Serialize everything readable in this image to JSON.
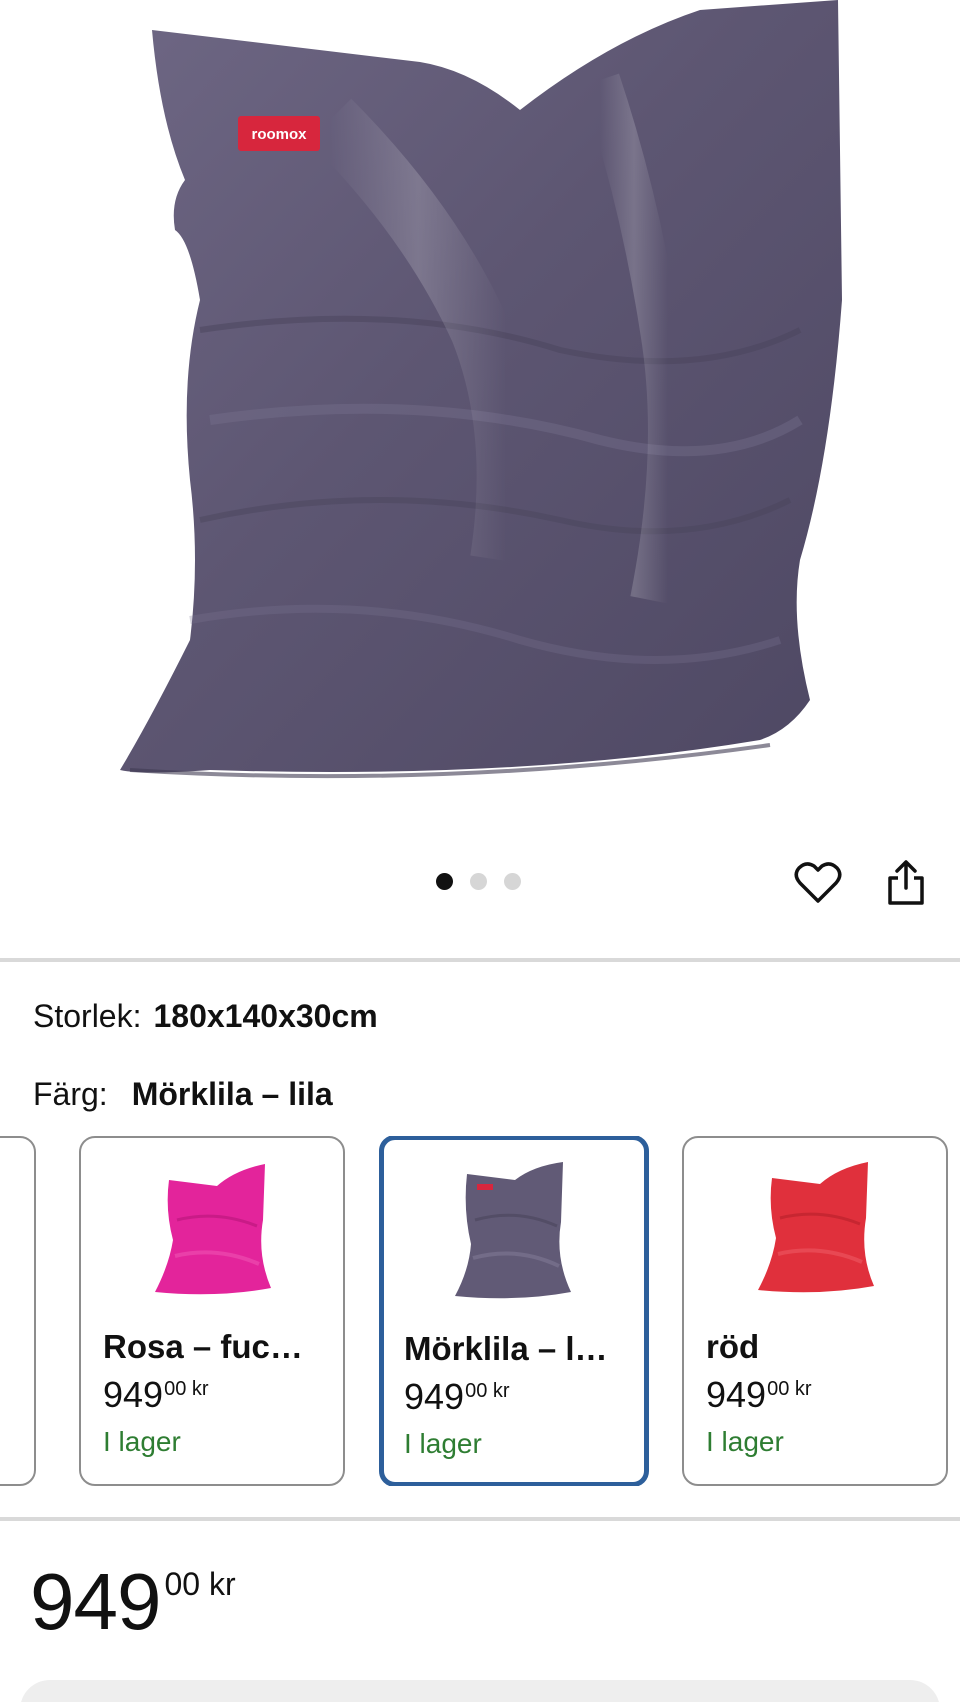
{
  "hero": {
    "logo_text": "roomox",
    "carousel": {
      "total": 3,
      "active": 1
    },
    "actions": {
      "favorite_icon": "heart-icon",
      "share_icon": "share-icon"
    }
  },
  "attributes": {
    "size_label": "Storlek:",
    "size_value": "180x140x30cm",
    "color_label": "Färg:",
    "color_value": "Mörklila – lila"
  },
  "variants": [
    {
      "name": "Rosa – fuc…",
      "price_main": "949",
      "price_sup": "00 kr",
      "stock": "I lager",
      "color": "#e3249b"
    },
    {
      "name": "Mörklila – l…",
      "price_main": "949",
      "price_sup": "00 kr",
      "stock": "I lager",
      "color": "#615a76",
      "selected": true
    },
    {
      "name": "röd",
      "price_main": "949",
      "price_sup": "00 kr",
      "stock": "I lager",
      "color": "#e0303c"
    }
  ],
  "price": {
    "main": "949",
    "sup": "00 kr"
  },
  "colors": {
    "accent_selected": "#2d5f9b",
    "stock_green": "#2e7d32",
    "product": "#5c5570"
  }
}
